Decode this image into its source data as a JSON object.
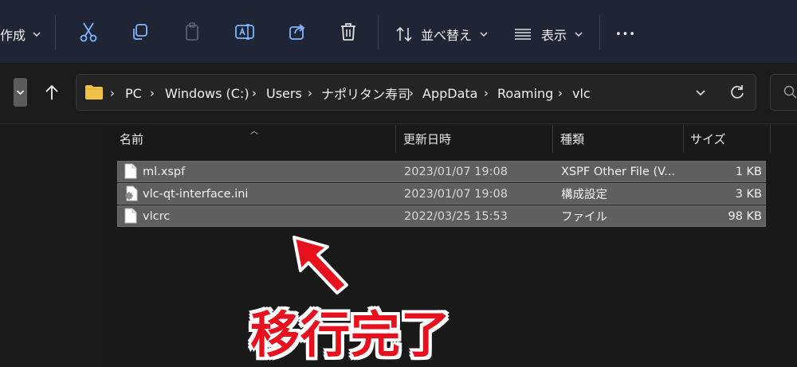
{
  "toolbar": {
    "new_label": "作成",
    "sort_label": "並べ替え",
    "view_label": "表示",
    "more_label": "•••",
    "icons": [
      "cut-icon",
      "copy-icon",
      "paste-icon",
      "rename-icon",
      "share-icon",
      "delete-icon",
      "sort-icon",
      "view-icon"
    ]
  },
  "address": {
    "breadcrumbs": [
      "PC",
      "Windows (C:)",
      "Users",
      "ナポリタン寿司",
      "AppData",
      "Roaming",
      "vlc"
    ],
    "separator": "›"
  },
  "columns": {
    "name": "名前",
    "modified": "更新日時",
    "type": "種類",
    "size": "サイズ"
  },
  "files": [
    {
      "name": "ml.xspf",
      "modified": "2023/01/07 19:08",
      "type": "XSPF Other File (V...",
      "size": "1 KB",
      "icon": "document-icon"
    },
    {
      "name": "vlc-qt-interface.ini",
      "modified": "2023/01/07 19:08",
      "type": "構成設定",
      "size": "3 KB",
      "icon": "config-file-icon"
    },
    {
      "name": "vlcrc",
      "modified": "2022/03/25 15:53",
      "type": "ファイル",
      "size": "98 KB",
      "icon": "document-icon"
    }
  ],
  "annotation": {
    "caption": "移行完了",
    "color": "#e8101d"
  },
  "colors": {
    "toolbar_bg": "#1f2535",
    "selection_bg": "#5f5f5f",
    "folder": "#f0c24a"
  }
}
